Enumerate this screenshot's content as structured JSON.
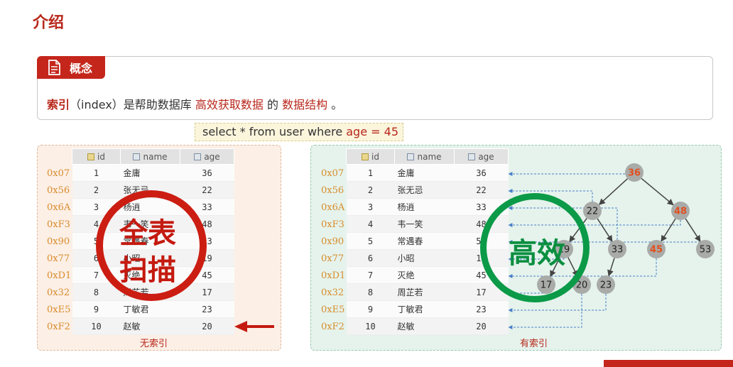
{
  "page": {
    "title": "介绍"
  },
  "concept": {
    "tag_label": "概念",
    "tag_icon": "document-icon",
    "sentence": {
      "term": "索引",
      "paren": "（index）是帮助数据库",
      "highlight1": "高效获取数据",
      "mid": "的",
      "highlight2": "数据结构",
      "end": "。"
    }
  },
  "sql": {
    "prefix": "select * from user where ",
    "condition": "age = 45"
  },
  "table": {
    "columns": [
      "id",
      "name",
      "age"
    ],
    "column_icons": [
      "key-column-icon",
      "column-icon",
      "column-icon"
    ],
    "rows": [
      {
        "addr": "0x07",
        "id": "1",
        "name": "金庸",
        "age": "36"
      },
      {
        "addr": "0x56",
        "id": "2",
        "name": "张无忌",
        "age": "22"
      },
      {
        "addr": "0x6A",
        "id": "3",
        "name": "杨逍",
        "age": "33"
      },
      {
        "addr": "0xF3",
        "id": "4",
        "name": "韦一笑",
        "age": "48"
      },
      {
        "addr": "0x90",
        "id": "5",
        "name": "常遇春",
        "age": "53"
      },
      {
        "addr": "0x77",
        "id": "6",
        "name": "小昭",
        "age": "19"
      },
      {
        "addr": "0xD1",
        "id": "7",
        "name": "灭绝",
        "age": "45"
      },
      {
        "addr": "0x32",
        "id": "8",
        "name": "周芷若",
        "age": "17"
      },
      {
        "addr": "0xE5",
        "id": "9",
        "name": "丁敏君",
        "age": "23"
      },
      {
        "addr": "0xF2",
        "id": "10",
        "name": "赵敏",
        "age": "20"
      }
    ]
  },
  "left_panel": {
    "caption": "无索引",
    "stamp_line1": "全表",
    "stamp_line2": "扫描",
    "arrow_color": "#c41a10"
  },
  "right_panel": {
    "caption": "有索引",
    "stamp_text": "高效",
    "tree_nodes": [
      "36",
      "22",
      "48",
      "19",
      "33",
      "45",
      "53",
      "17",
      "20",
      "23"
    ],
    "highlighted_nodes": [
      "36",
      "48",
      "45"
    ]
  },
  "colors": {
    "brand_red": "#c4261b",
    "stamp_green": "#0b9a47",
    "address_orange": "#d88c2c",
    "node_fill": "#a9aba9",
    "node_highlight_text": "#e0501e",
    "pointer_blue": "#4a7fc8"
  }
}
